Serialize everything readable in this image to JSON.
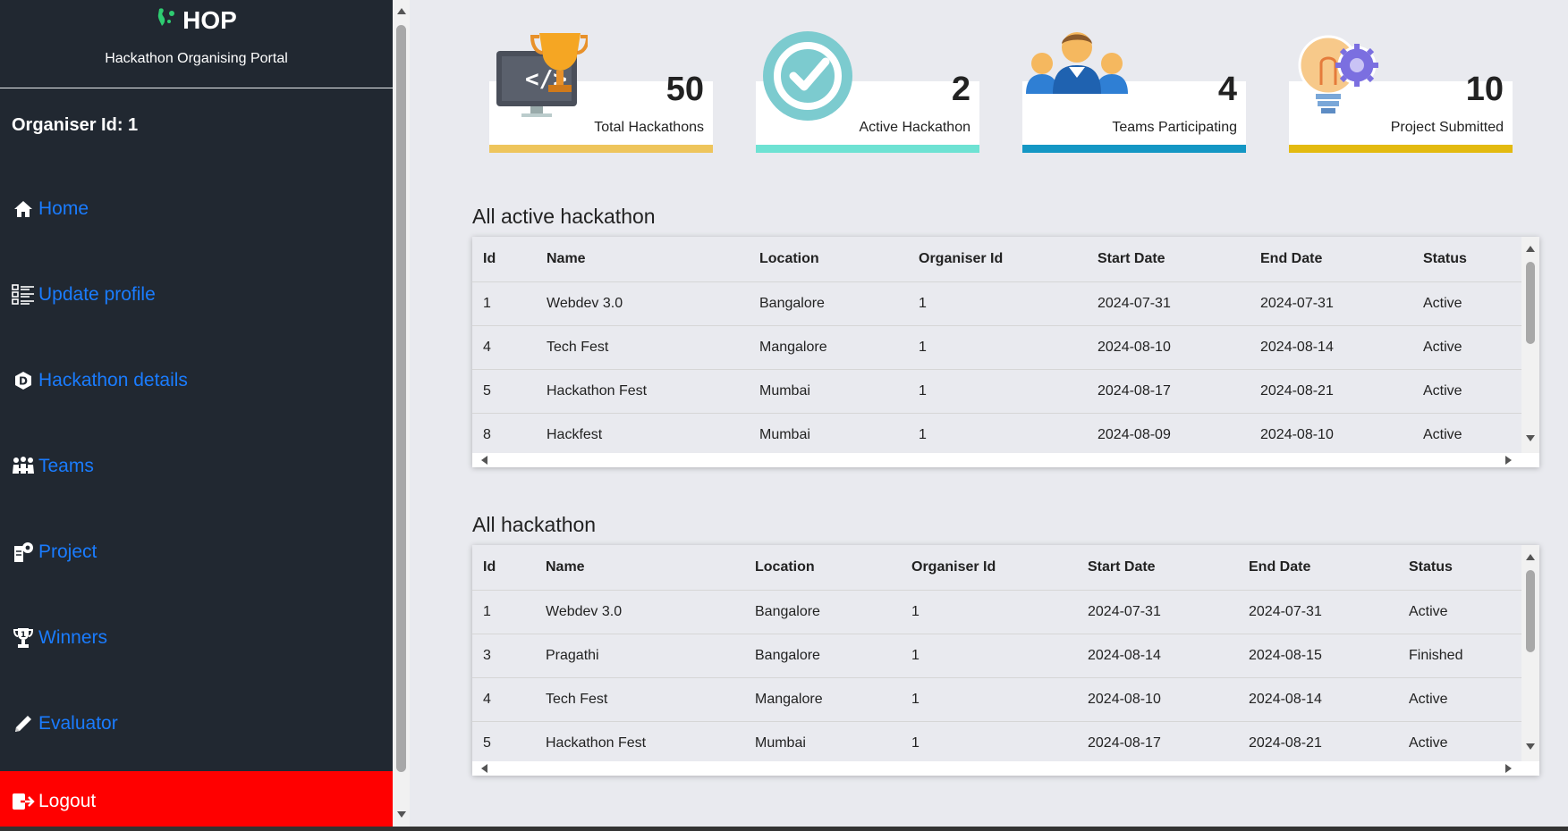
{
  "brand": {
    "title": "HOP",
    "subtitle": "Hackathon Organising Portal"
  },
  "organiser": {
    "label": "Organiser Id: 1"
  },
  "nav": [
    {
      "label": "Home",
      "icon": "home-icon"
    },
    {
      "label": "Update profile",
      "icon": "list-icon"
    },
    {
      "label": "Hackathon details",
      "icon": "hexagon-d-icon"
    },
    {
      "label": "Teams",
      "icon": "team-icon"
    },
    {
      "label": "Project",
      "icon": "project-gear-icon"
    },
    {
      "label": "Winners",
      "icon": "trophy-icon"
    },
    {
      "label": "Evaluator",
      "icon": "pencil-icon"
    }
  ],
  "logout": {
    "label": "Logout",
    "icon": "logout-icon"
  },
  "cards": [
    {
      "value": "50",
      "label": "Total Hackathons",
      "color": "#eec55c",
      "icon": "monitor-trophy-icon"
    },
    {
      "value": "2",
      "label": "Active Hackathon",
      "color": "#6ee2d3",
      "icon": "check-circle-icon"
    },
    {
      "value": "4",
      "label": "Teams Participating",
      "color": "#1497c4",
      "icon": "people-icon"
    },
    {
      "value": "10",
      "label": "Project Submitted",
      "color": "#e3ba10",
      "icon": "bulb-gear-icon"
    }
  ],
  "active_table": {
    "title": "All active hackathon",
    "columns": [
      "Id",
      "Name",
      "Location",
      "Organiser Id",
      "Start Date",
      "End Date",
      "Status"
    ],
    "rows": [
      [
        "1",
        "Webdev 3.0",
        "Bangalore",
        "1",
        "2024-07-31",
        "2024-07-31",
        "Active"
      ],
      [
        "4",
        "Tech Fest",
        "Mangalore",
        "1",
        "2024-08-10",
        "2024-08-14",
        "Active"
      ],
      [
        "5",
        "Hackathon Fest",
        "Mumbai",
        "1",
        "2024-08-17",
        "2024-08-21",
        "Active"
      ],
      [
        "8",
        "Hackfest",
        "Mumbai",
        "1",
        "2024-08-09",
        "2024-08-10",
        "Active"
      ]
    ]
  },
  "all_table": {
    "title": "All hackathon",
    "columns": [
      "Id",
      "Name",
      "Location",
      "Organiser Id",
      "Start Date",
      "End Date",
      "Status"
    ],
    "rows": [
      [
        "1",
        "Webdev 3.0",
        "Bangalore",
        "1",
        "2024-07-31",
        "2024-07-31",
        "Active"
      ],
      [
        "3",
        "Pragathi",
        "Bangalore",
        "1",
        "2024-08-14",
        "2024-08-15",
        "Finished"
      ],
      [
        "4",
        "Tech Fest",
        "Mangalore",
        "1",
        "2024-08-10",
        "2024-08-14",
        "Active"
      ],
      [
        "5",
        "Hackathon Fest",
        "Mumbai",
        "1",
        "2024-08-17",
        "2024-08-21",
        "Active"
      ]
    ]
  }
}
